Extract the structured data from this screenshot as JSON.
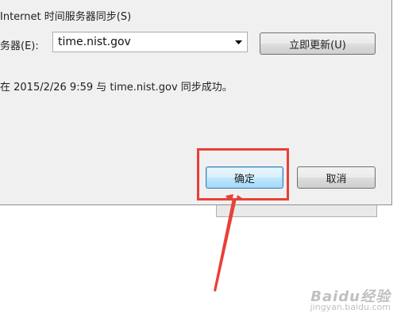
{
  "dialog": {
    "sync_checkbox_label": "Internet 时间服务器同步(S)",
    "server_label": "务器(E):",
    "server_value": "time.nist.gov",
    "update_button": "立即更新(U)",
    "status_message": "在 2015/2/26 9:59 与 time.nist.gov 同步成功。",
    "ok_button": "确定",
    "cancel_button": "取消"
  },
  "annotation": {
    "color": "#e8403a"
  },
  "watermark": {
    "logo_text": "Baidu经验",
    "url": "jingyan.baidu.com"
  }
}
